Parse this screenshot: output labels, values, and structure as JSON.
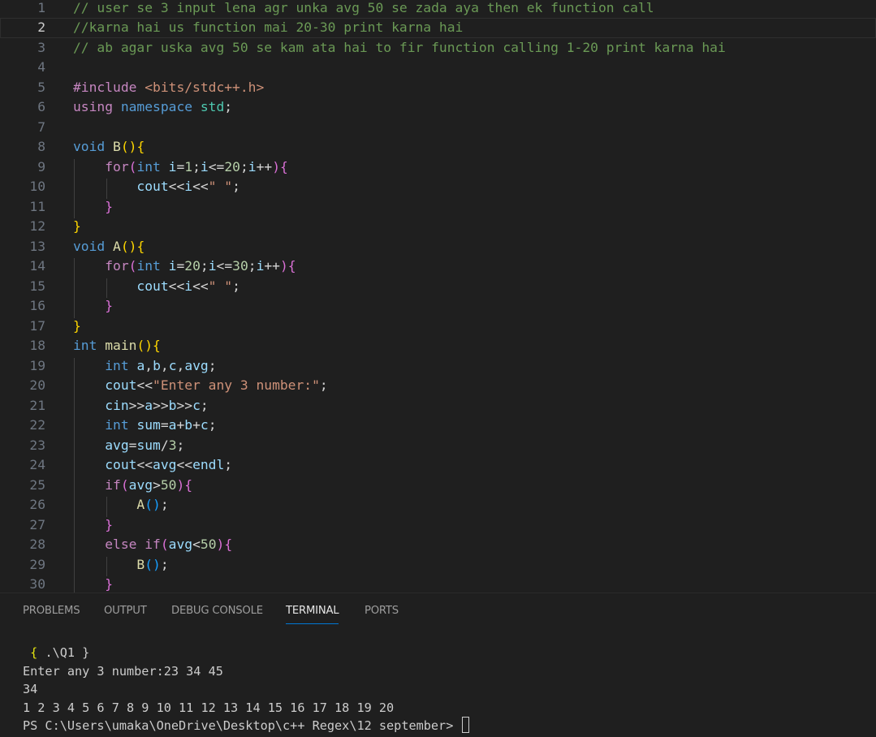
{
  "editor": {
    "active_line": 2,
    "lines": [
      {
        "n": "1",
        "tokens": [
          [
            "c-com",
            "// user se 3 input lena agr unka avg 50 se zada aya then ek function call"
          ]
        ]
      },
      {
        "n": "2",
        "tokens": [
          [
            "c-com",
            "//karna hai us function mai 20-30 print karna hai"
          ]
        ]
      },
      {
        "n": "3",
        "tokens": [
          [
            "c-com",
            "// ab agar uska avg 50 se kam ata hai to fir function calling 1-20 print karna hai"
          ]
        ]
      },
      {
        "n": "4",
        "tokens": []
      },
      {
        "n": "5",
        "tokens": [
          [
            "c-ctl",
            "#include "
          ],
          [
            "c-inc",
            "<bits/stdc++.h>"
          ]
        ]
      },
      {
        "n": "6",
        "tokens": [
          [
            "c-ctl",
            "using "
          ],
          [
            "c-kw",
            "namespace "
          ],
          [
            "c-type",
            "std"
          ],
          [
            "c-op",
            ";"
          ]
        ]
      },
      {
        "n": "7",
        "tokens": []
      },
      {
        "n": "8",
        "tokens": [
          [
            "c-kw",
            "void "
          ],
          [
            "c-fn",
            "B"
          ],
          [
            "b1",
            "()"
          ],
          [
            "b1",
            "{"
          ]
        ]
      },
      {
        "n": "9",
        "tokens": [
          [
            "c-op",
            "    "
          ],
          [
            "c-ctl",
            "for"
          ],
          [
            "b2",
            "("
          ],
          [
            "c-kw",
            "int "
          ],
          [
            "c-id",
            "i"
          ],
          [
            "c-op",
            "="
          ],
          [
            "c-num",
            "1"
          ],
          [
            "c-op",
            ";"
          ],
          [
            "c-id",
            "i"
          ],
          [
            "c-op",
            "<="
          ],
          [
            "c-num",
            "20"
          ],
          [
            "c-op",
            ";"
          ],
          [
            "c-id",
            "i"
          ],
          [
            "c-op",
            "++"
          ],
          [
            "b2",
            ")"
          ],
          [
            "b2",
            "{"
          ]
        ]
      },
      {
        "n": "10",
        "tokens": [
          [
            "c-op",
            "        "
          ],
          [
            "c-id",
            "cout"
          ],
          [
            "c-op",
            "<<"
          ],
          [
            "c-id",
            "i"
          ],
          [
            "c-op",
            "<<"
          ],
          [
            "c-str",
            "\" \""
          ],
          [
            "c-op",
            ";"
          ]
        ]
      },
      {
        "n": "11",
        "tokens": [
          [
            "c-op",
            "    "
          ],
          [
            "b2",
            "}"
          ]
        ]
      },
      {
        "n": "12",
        "tokens": [
          [
            "b1",
            "}"
          ]
        ]
      },
      {
        "n": "13",
        "tokens": [
          [
            "c-kw",
            "void "
          ],
          [
            "c-fn",
            "A"
          ],
          [
            "b1",
            "()"
          ],
          [
            "b1",
            "{"
          ]
        ]
      },
      {
        "n": "14",
        "tokens": [
          [
            "c-op",
            "    "
          ],
          [
            "c-ctl",
            "for"
          ],
          [
            "b2",
            "("
          ],
          [
            "c-kw",
            "int "
          ],
          [
            "c-id",
            "i"
          ],
          [
            "c-op",
            "="
          ],
          [
            "c-num",
            "20"
          ],
          [
            "c-op",
            ";"
          ],
          [
            "c-id",
            "i"
          ],
          [
            "c-op",
            "<="
          ],
          [
            "c-num",
            "30"
          ],
          [
            "c-op",
            ";"
          ],
          [
            "c-id",
            "i"
          ],
          [
            "c-op",
            "++"
          ],
          [
            "b2",
            ")"
          ],
          [
            "b2",
            "{"
          ]
        ]
      },
      {
        "n": "15",
        "tokens": [
          [
            "c-op",
            "        "
          ],
          [
            "c-id",
            "cout"
          ],
          [
            "c-op",
            "<<"
          ],
          [
            "c-id",
            "i"
          ],
          [
            "c-op",
            "<<"
          ],
          [
            "c-str",
            "\" \""
          ],
          [
            "c-op",
            ";"
          ]
        ]
      },
      {
        "n": "16",
        "tokens": [
          [
            "c-op",
            "    "
          ],
          [
            "b2",
            "}"
          ]
        ]
      },
      {
        "n": "17",
        "tokens": [
          [
            "b1",
            "}"
          ]
        ]
      },
      {
        "n": "18",
        "tokens": [
          [
            "c-kw",
            "int "
          ],
          [
            "c-fn",
            "main"
          ],
          [
            "b1",
            "()"
          ],
          [
            "b1",
            "{"
          ]
        ]
      },
      {
        "n": "19",
        "tokens": [
          [
            "c-op",
            "    "
          ],
          [
            "c-kw",
            "int "
          ],
          [
            "c-id",
            "a"
          ],
          [
            "c-op",
            ","
          ],
          [
            "c-id",
            "b"
          ],
          [
            "c-op",
            ","
          ],
          [
            "c-id",
            "c"
          ],
          [
            "c-op",
            ","
          ],
          [
            "c-id",
            "avg"
          ],
          [
            "c-op",
            ";"
          ]
        ]
      },
      {
        "n": "20",
        "tokens": [
          [
            "c-op",
            "    "
          ],
          [
            "c-id",
            "cout"
          ],
          [
            "c-op",
            "<<"
          ],
          [
            "c-str",
            "\"Enter any 3 number:\""
          ],
          [
            "c-op",
            ";"
          ]
        ]
      },
      {
        "n": "21",
        "tokens": [
          [
            "c-op",
            "    "
          ],
          [
            "c-id",
            "cin"
          ],
          [
            "c-op",
            ">>"
          ],
          [
            "c-id",
            "a"
          ],
          [
            "c-op",
            ">>"
          ],
          [
            "c-id",
            "b"
          ],
          [
            "c-op",
            ">>"
          ],
          [
            "c-id",
            "c"
          ],
          [
            "c-op",
            ";"
          ]
        ]
      },
      {
        "n": "22",
        "tokens": [
          [
            "c-op",
            "    "
          ],
          [
            "c-kw",
            "int "
          ],
          [
            "c-id",
            "sum"
          ],
          [
            "c-op",
            "="
          ],
          [
            "c-id",
            "a"
          ],
          [
            "c-op",
            "+"
          ],
          [
            "c-id",
            "b"
          ],
          [
            "c-op",
            "+"
          ],
          [
            "c-id",
            "c"
          ],
          [
            "c-op",
            ";"
          ]
        ]
      },
      {
        "n": "23",
        "tokens": [
          [
            "c-op",
            "    "
          ],
          [
            "c-id",
            "avg"
          ],
          [
            "c-op",
            "="
          ],
          [
            "c-id",
            "sum"
          ],
          [
            "c-op",
            "/"
          ],
          [
            "c-num",
            "3"
          ],
          [
            "c-op",
            ";"
          ]
        ]
      },
      {
        "n": "24",
        "tokens": [
          [
            "c-op",
            "    "
          ],
          [
            "c-id",
            "cout"
          ],
          [
            "c-op",
            "<<"
          ],
          [
            "c-id",
            "avg"
          ],
          [
            "c-op",
            "<<"
          ],
          [
            "c-id",
            "endl"
          ],
          [
            "c-op",
            ";"
          ]
        ]
      },
      {
        "n": "25",
        "tokens": [
          [
            "c-op",
            "    "
          ],
          [
            "c-ctl",
            "if"
          ],
          [
            "b2",
            "("
          ],
          [
            "c-id",
            "avg"
          ],
          [
            "c-op",
            ">"
          ],
          [
            "c-num",
            "50"
          ],
          [
            "b2",
            ")"
          ],
          [
            "b2",
            "{"
          ]
        ]
      },
      {
        "n": "26",
        "tokens": [
          [
            "c-op",
            "        "
          ],
          [
            "c-fn",
            "A"
          ],
          [
            "b3",
            "()"
          ],
          [
            "c-op",
            ";"
          ]
        ]
      },
      {
        "n": "27",
        "tokens": [
          [
            "c-op",
            "    "
          ],
          [
            "b2",
            "}"
          ]
        ]
      },
      {
        "n": "28",
        "tokens": [
          [
            "c-op",
            "    "
          ],
          [
            "c-ctl",
            "else if"
          ],
          [
            "b2",
            "("
          ],
          [
            "c-id",
            "avg"
          ],
          [
            "c-op",
            "<"
          ],
          [
            "c-num",
            "50"
          ],
          [
            "b2",
            ")"
          ],
          [
            "b2",
            "{"
          ]
        ]
      },
      {
        "n": "29",
        "tokens": [
          [
            "c-op",
            "        "
          ],
          [
            "c-fn",
            "B"
          ],
          [
            "b3",
            "()"
          ],
          [
            "c-op",
            ";"
          ]
        ]
      },
      {
        "n": "30",
        "tokens": [
          [
            "c-op",
            "    "
          ],
          [
            "b2",
            "}"
          ]
        ]
      }
    ]
  },
  "panel": {
    "tabs": [
      {
        "label": "PROBLEMS",
        "active": false
      },
      {
        "label": "OUTPUT",
        "active": false
      },
      {
        "label": "DEBUG CONSOLE",
        "active": false
      },
      {
        "label": "TERMINAL",
        "active": true
      },
      {
        "label": "PORTS",
        "active": false
      }
    ],
    "terminal": {
      "cmd_open": " { ",
      "cmd_text": ".\\Q1",
      "cmd_close": " }",
      "line_prompt_input": "Enter any 3 number:23 34 45",
      "line_avg": "34",
      "line_output": "1 2 3 4 5 6 7 8 9 10 11 12 13 14 15 16 17 18 19 20",
      "prompt": "PS C:\\Users\\umaka\\OneDrive\\Desktop\\c++ Regex\\12 september> "
    }
  }
}
